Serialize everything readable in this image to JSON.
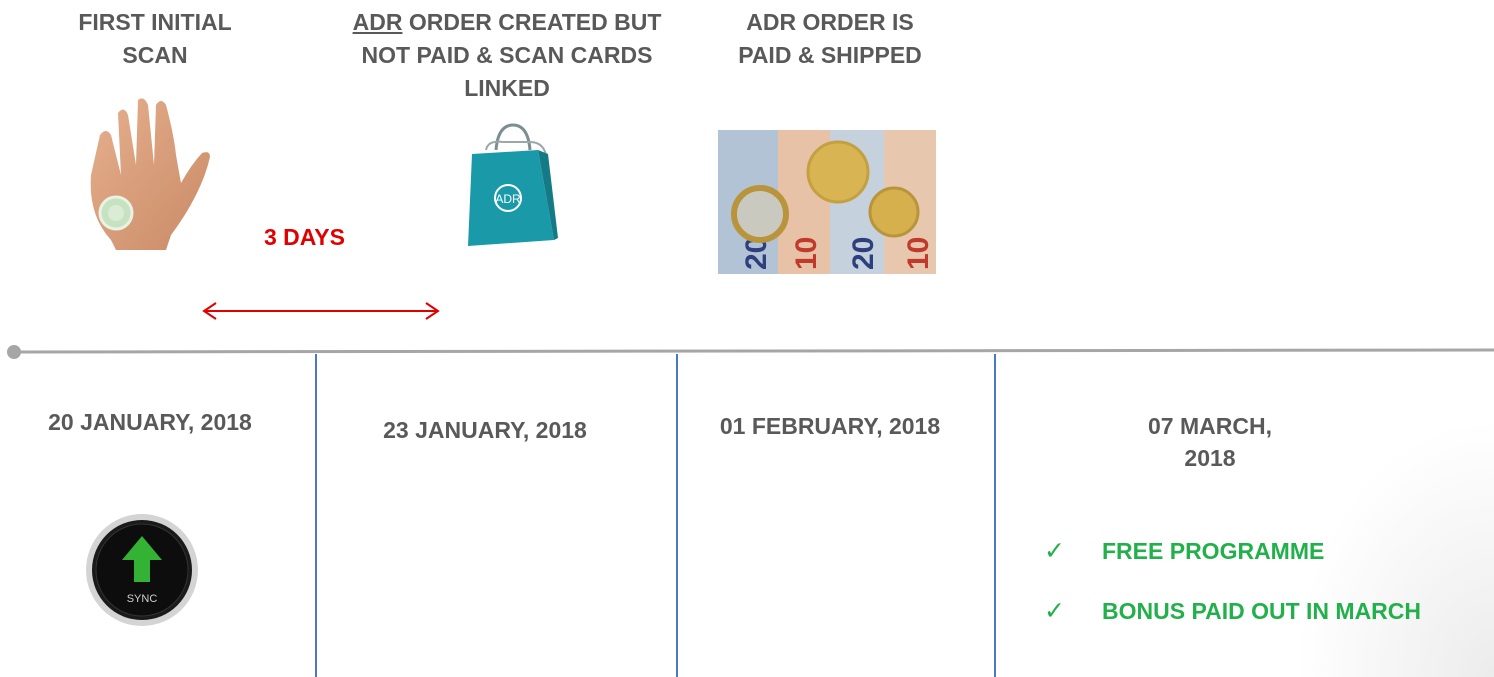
{
  "milestones": [
    {
      "header_line1": "FIRST INITIAL",
      "header_line2": "SCAN",
      "date": "20 JANUARY, 2018"
    },
    {
      "header_prefix": "ADR",
      "header_line1_rest": " ORDER CREATED BUT",
      "header_line2": "NOT PAID & SCAN CARDS",
      "header_line3": "LINKED",
      "date": "23 JANUARY, 2018"
    },
    {
      "header_line1": "ADR ORDER IS",
      "header_line2": "PAID & SHIPPED",
      "date": "01 FEBRUARY, 2018"
    },
    {
      "date_line1": "07 MARCH,",
      "date_line2": "2018"
    }
  ],
  "interval_label": "3 DAYS",
  "sync_label": "SYNC",
  "bag_logo_text": "ADR",
  "checklist": [
    "FREE PROGRAMME",
    "BONUS PAID OUT IN MARCH"
  ],
  "colors": {
    "text": "#595959",
    "interval": "#e00000",
    "divider": "#4a78c2",
    "timeline": "#a6a6a6",
    "checklist": "#22b04b",
    "bag": "#1a9aa8"
  },
  "icons": [
    "hand-scan-icon",
    "shopping-bag-icon",
    "euro-money-icon",
    "sync-button-icon",
    "checkmark-icon"
  ]
}
